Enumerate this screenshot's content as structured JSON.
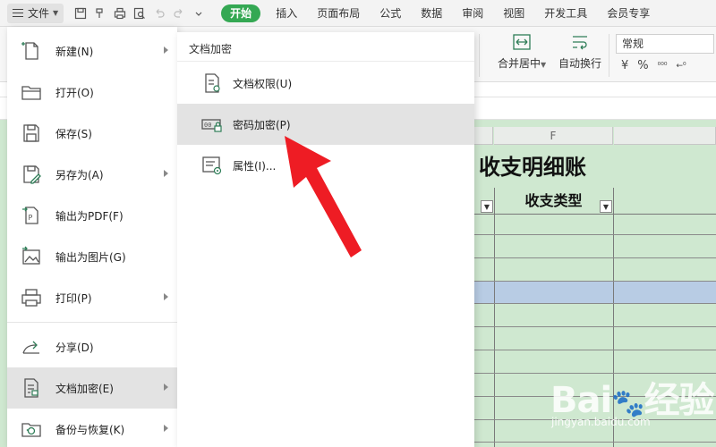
{
  "topbar": {
    "file_label": "文件",
    "tabs": [
      {
        "label": "开始",
        "active": true
      },
      {
        "label": "插入"
      },
      {
        "label": "页面布局"
      },
      {
        "label": "公式"
      },
      {
        "label": "数据"
      },
      {
        "label": "审阅"
      },
      {
        "label": "视图"
      },
      {
        "label": "开发工具"
      },
      {
        "label": "会员专享"
      }
    ]
  },
  "ribbon": {
    "merge_label": "合并居中",
    "wrap_label": "自动换行",
    "number_format": "常规",
    "currency_symbol": "¥",
    "percent_symbol": "%"
  },
  "file_menu": {
    "items": [
      {
        "label": "新建(N)",
        "icon": "new-file-icon",
        "submenu": true
      },
      {
        "label": "打开(O)",
        "icon": "open-folder-icon",
        "submenu": false
      },
      {
        "label": "保存(S)",
        "icon": "save-icon",
        "submenu": false
      },
      {
        "label": "另存为(A)",
        "icon": "save-as-icon",
        "submenu": true
      },
      {
        "label": "输出为PDF(F)",
        "icon": "export-pdf-icon",
        "submenu": false
      },
      {
        "label": "输出为图片(G)",
        "icon": "export-image-icon",
        "submenu": false
      },
      {
        "label": "打印(P)",
        "icon": "print-icon",
        "submenu": true
      },
      {
        "label": "分享(D)",
        "icon": "share-icon",
        "submenu": false
      },
      {
        "label": "文档加密(E)",
        "icon": "document-encrypt-icon",
        "submenu": true,
        "active": true
      },
      {
        "label": "备份与恢复(K)",
        "icon": "backup-restore-icon",
        "submenu": true
      }
    ]
  },
  "submenu": {
    "title": "文档加密",
    "items": [
      {
        "label": "文档权限(U)",
        "icon": "document-permission-icon"
      },
      {
        "label": "密码加密(P)",
        "icon": "password-encrypt-icon",
        "active": true
      },
      {
        "label": "属性(I)...",
        "icon": "properties-icon"
      }
    ]
  },
  "sheet": {
    "column_label": "F",
    "title": "收支明细账",
    "header_type": "收支类型",
    "row_highlight_color": "#b8cce4",
    "sheet_bg_color": "#cfe8d0"
  },
  "accent_color": "#34a853",
  "arrow_color": "#ee1c24",
  "watermark": {
    "brand": "Bai",
    "brand_suffix": "经验",
    "url": "jingyan.baidu.com"
  }
}
